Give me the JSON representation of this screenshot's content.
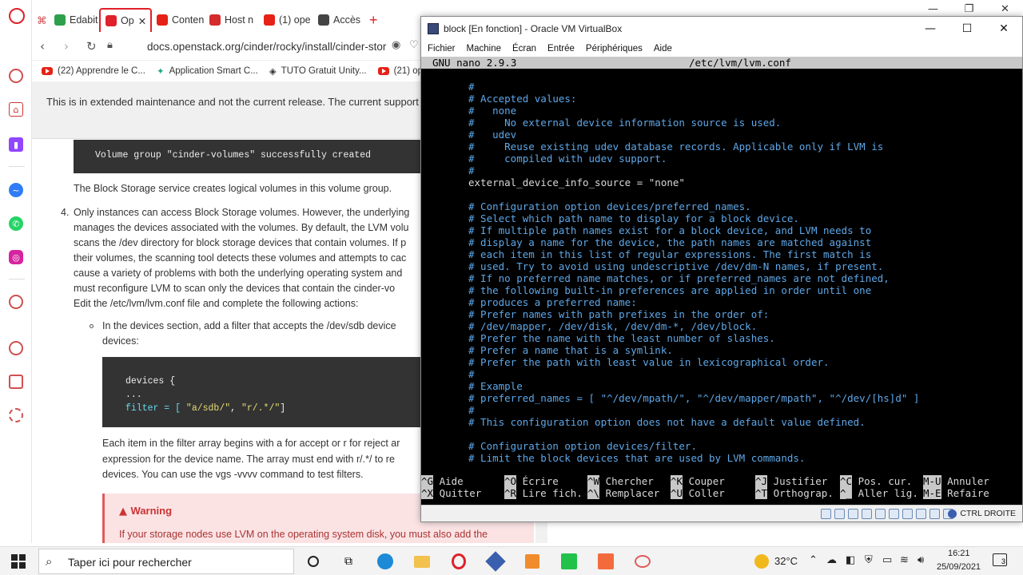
{
  "browser": {
    "tabs": [
      {
        "label": "Edabit",
        "color": "#2e9f4b"
      },
      {
        "label": "Op",
        "color": "#e0202a"
      },
      {
        "label": "Conten",
        "color": "#e62117"
      },
      {
        "label": "Host n",
        "color": "#d42b2b"
      },
      {
        "label": "(1) ope",
        "color": "#e62117"
      },
      {
        "label": "Accès",
        "color": "#444444"
      }
    ],
    "address": "docs.openstack.org/cinder/rocky/install/cinder-stor",
    "bookmarks": [
      "(22) Apprendre le C...",
      "Application Smart C...",
      "TUTO Gratuit Unity...",
      "(21) op"
    ]
  },
  "doc": {
    "notice": "This is in extended maintenance and not the current release. The current support",
    "vg_output": "Volume group \"cinder-volumes\" successfully created",
    "p1": "The Block Storage service creates logical volumes in this volume group.",
    "item_number": "4.",
    "item_lines": [
      "Only instances can access Block Storage volumes. However, the underlying",
      "manages the devices associated with the volumes. By default, the LVM volu",
      "scans the /dev directory for block storage devices that contain volumes. If p",
      "their volumes, the scanning tool detects these volumes and attempts to cac",
      "cause a variety of problems with both the underlying operating system and",
      "must reconfigure LVM to scan only the devices that contain the cinder-vo",
      "Edit the /etc/lvm/lvm.conf file and complete the following actions:"
    ],
    "bullet_lines": [
      "In the devices section, add a filter that accepts the /dev/sdb device",
      "devices:"
    ],
    "code": {
      "line1": "devices {",
      "line2": "...",
      "line3_key": "filter = [ ",
      "line3_s1": "\"a/sdb/\"",
      "line3_sep": ", ",
      "line3_s2": "\"r/.*/\"",
      "line3_end": "]"
    },
    "after_code": [
      "Each item in the filter array begins with a for accept or r for reject ar",
      "expression for the device name. The array must end with r/.*/ to re",
      "devices. You can use the vgs -vvvv command to test filters."
    ],
    "warning_title": "Warning",
    "warning_text": "If your storage nodes use LVM on the operating system disk, you must also add the"
  },
  "vbox": {
    "title": "block [En fonction] - Oracle VM VirtualBox",
    "menu": [
      "Fichier",
      "Machine",
      "Écran",
      "Entrée",
      "Périphériques",
      "Aide"
    ],
    "host_key": "CTRL DROITE"
  },
  "nano": {
    "version": "GNU nano 2.9.3",
    "filename": "/etc/lvm/lvm.conf",
    "lines": [
      {
        "t": "#",
        "c": false
      },
      {
        "t": "# Accepted values:",
        "c": false
      },
      {
        "t": "#   none",
        "c": false
      },
      {
        "t": "#     No external device information source is used.",
        "c": false
      },
      {
        "t": "#   udev",
        "c": false
      },
      {
        "t": "#     Reuse existing udev database records. Applicable only if LVM is",
        "c": false
      },
      {
        "t": "#     compiled with udev support.",
        "c": false
      },
      {
        "t": "#",
        "c": false
      },
      {
        "t": "external_device_info_source = \"none\"",
        "c": true
      },
      {
        "t": "",
        "c": true
      },
      {
        "t": "# Configuration option devices/preferred_names.",
        "c": false
      },
      {
        "t": "# Select which path name to display for a block device.",
        "c": false
      },
      {
        "t": "# If multiple path names exist for a block device, and LVM needs to",
        "c": false
      },
      {
        "t": "# display a name for the device, the path names are matched against",
        "c": false
      },
      {
        "t": "# each item in this list of regular expressions. The first match is",
        "c": false
      },
      {
        "t": "# used. Try to avoid using undescriptive /dev/dm-N names, if present.",
        "c": false
      },
      {
        "t": "# If no preferred name matches, or if preferred_names are not defined,",
        "c": false
      },
      {
        "t": "# the following built-in preferences are applied in order until one",
        "c": false
      },
      {
        "t": "# produces a preferred name:",
        "c": false
      },
      {
        "t": "# Prefer names with path prefixes in the order of:",
        "c": false
      },
      {
        "t": "# /dev/mapper, /dev/disk, /dev/dm-*, /dev/block.",
        "c": false
      },
      {
        "t": "# Prefer the name with the least number of slashes.",
        "c": false
      },
      {
        "t": "# Prefer a name that is a symlink.",
        "c": false
      },
      {
        "t": "# Prefer the path with least value in lexicographical order.",
        "c": false
      },
      {
        "t": "#",
        "c": false
      },
      {
        "t": "# Example",
        "c": false
      },
      {
        "t": "# preferred_names = [ \"^/dev/mpath/\", \"^/dev/mapper/mpath\", \"^/dev/[hs]d\" ]",
        "c": false
      },
      {
        "t": "#",
        "c": false
      },
      {
        "t": "# This configuration option does not have a default value defined.",
        "c": false
      },
      {
        "t": "",
        "c": true
      },
      {
        "t": "# Configuration option devices/filter.",
        "c": false
      },
      {
        "t": "# Limit the block devices that are used by LVM commands.",
        "c": false
      }
    ],
    "shortcuts": [
      {
        "key": "^G",
        "label": "Aide"
      },
      {
        "key": "^O",
        "label": "Écrire"
      },
      {
        "key": "^W",
        "label": "Chercher"
      },
      {
        "key": "^K",
        "label": "Couper"
      },
      {
        "key": "^J",
        "label": "Justifier"
      },
      {
        "key": "^C",
        "label": "Pos. cur."
      },
      {
        "key": "M-U",
        "label": "Annuler"
      },
      {
        "key": "^X",
        "label": "Quitter"
      },
      {
        "key": "^R",
        "label": "Lire fich."
      },
      {
        "key": "^\\",
        "label": "Remplacer"
      },
      {
        "key": "^U",
        "label": "Coller"
      },
      {
        "key": "^T",
        "label": "Orthograp."
      },
      {
        "key": "^_",
        "label": "Aller lig."
      },
      {
        "key": "M-E",
        "label": "Refaire"
      }
    ]
  },
  "taskbar": {
    "search_placeholder": "Taper ici pour rechercher",
    "temperature": "32°C",
    "time": "16:21",
    "date": "25/09/2021",
    "notification_count": "3"
  }
}
